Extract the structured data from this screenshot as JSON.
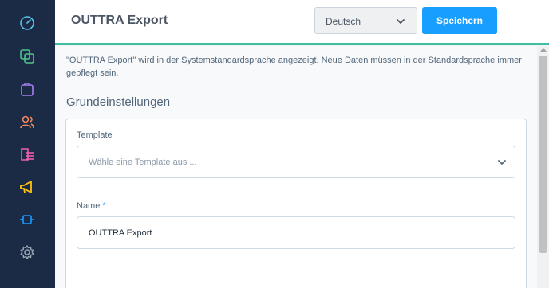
{
  "header": {
    "title": "OUTTRA Export",
    "language": "Deutsch",
    "save_label": "Speichern"
  },
  "sidebar": {
    "icons": [
      "dashboard-icon",
      "catalog-icon",
      "orders-icon",
      "customers-icon",
      "content-icon",
      "marketing-icon",
      "extensions-icon",
      "settings-icon"
    ]
  },
  "main": {
    "notice": "\"OUTTRA Export\" wird in der Systemstandardsprache angezeigt. Neue Daten müssen in der Standardsprache immer gepflegt sein.",
    "section_title": "Grundeinstellungen",
    "template": {
      "label": "Template",
      "placeholder": "Wähle eine Template aus ..."
    },
    "name": {
      "label": "Name",
      "required_marker": "*",
      "value": "OUTTRA Export"
    }
  },
  "colors": {
    "sidebar_bg": "#1b2a45",
    "accent": "#189eff",
    "header_border": "#3fbfa0"
  }
}
